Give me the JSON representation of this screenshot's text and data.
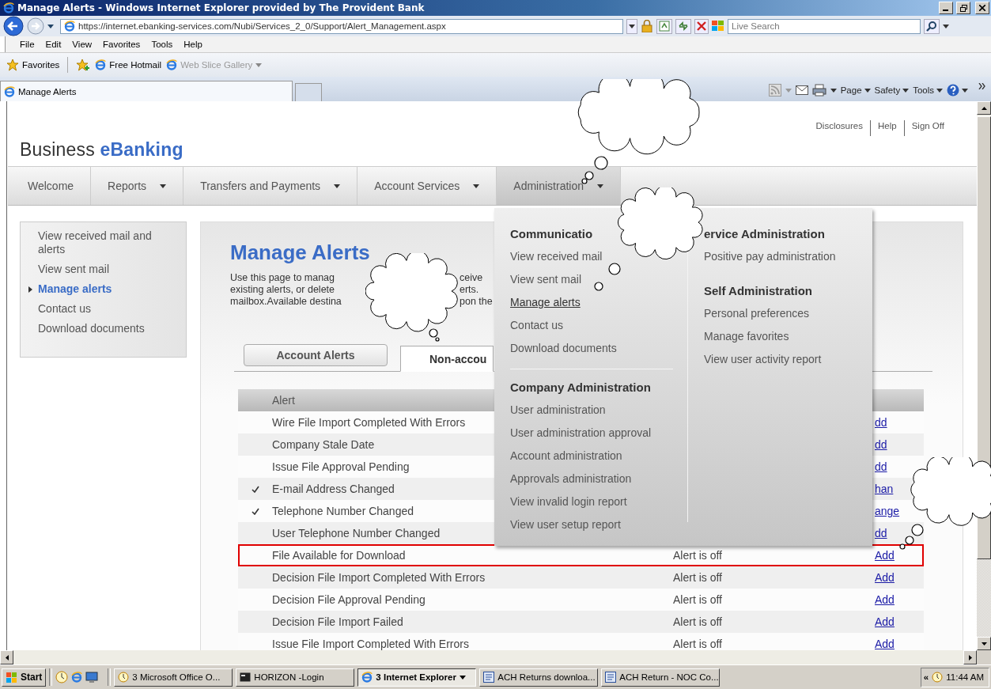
{
  "window": {
    "title": "Manage Alerts - Windows Internet Explorer provided by The Provident Bank"
  },
  "address_bar": {
    "url": "https://internet.ebanking-services.com/Nubi/Services_2_0/Support/Alert_Management.aspx"
  },
  "search": {
    "placeholder": "Live Search"
  },
  "menu_bar": [
    "File",
    "Edit",
    "View",
    "Favorites",
    "Tools",
    "Help"
  ],
  "favorites_bar": {
    "label": "Favorites",
    "links": [
      {
        "label": "Free Hotmail",
        "disabled": false,
        "dropdown": false
      },
      {
        "label": "Web Slice Gallery",
        "disabled": true,
        "dropdown": true
      }
    ]
  },
  "browser_tabs": [
    {
      "label": "Manage Alerts",
      "selected": true
    }
  ],
  "command_bar": [
    "Page",
    "Safety",
    "Tools"
  ],
  "site": {
    "top_links": [
      "Disclosures",
      "Help",
      "Sign Off"
    ],
    "logo": {
      "plain": "Business",
      "accent": "eBanking"
    },
    "nav": [
      {
        "label": "Welcome",
        "dropdown": false,
        "selected": false
      },
      {
        "label": "Reports",
        "dropdown": true,
        "selected": false
      },
      {
        "label": "Transfers and Payments",
        "dropdown": true,
        "selected": false
      },
      {
        "label": "Account Services",
        "dropdown": true,
        "selected": false
      },
      {
        "label": "Administration",
        "dropdown": true,
        "selected": true
      }
    ],
    "sidebar": [
      {
        "label": "View received mail and alerts",
        "selected": false
      },
      {
        "label": "View sent mail",
        "selected": false
      },
      {
        "label": "Manage alerts",
        "selected": true
      },
      {
        "label": "Contact us",
        "selected": false
      },
      {
        "label": "Download documents",
        "selected": false
      }
    ],
    "heading": "Manage Alerts",
    "intro_lines": [
      {
        "left": "Use this page to manag",
        "right": "ceive"
      },
      {
        "left": "existing alerts, or delete",
        "right": "erts."
      },
      {
        "left": "mailbox.Available destina",
        "right": "pon the"
      }
    ],
    "tabs": [
      {
        "label": "Account Alerts",
        "selected": false
      },
      {
        "label": "Non-accou",
        "selected": true
      }
    ],
    "table": {
      "columns": [
        "Alert"
      ],
      "rows": [
        {
          "alert": "Wire File Import Completed With Errors",
          "checked": false,
          "highlighted": false,
          "action": "dd"
        },
        {
          "alert": "Company Stale Date",
          "checked": false,
          "highlighted": false,
          "action": "dd"
        },
        {
          "alert": "Issue File Approval Pending",
          "checked": false,
          "highlighted": false,
          "action": "dd"
        },
        {
          "alert": "E-mail Address Changed",
          "checked": true,
          "highlighted": false,
          "action": "han"
        },
        {
          "alert": "Telephone Number Changed",
          "checked": true,
          "highlighted": false,
          "action": "ange"
        },
        {
          "alert": "User Telephone Number Changed",
          "checked": false,
          "highlighted": false,
          "action": "dd"
        },
        {
          "alert": "File Available for Download",
          "checked": false,
          "highlighted": true,
          "status": "Alert is off",
          "action": "Add"
        },
        {
          "alert": "Decision File Import Completed With Errors",
          "checked": false,
          "highlighted": false,
          "status": "Alert is off",
          "action": "Add"
        },
        {
          "alert": "Decision File Approval Pending",
          "checked": false,
          "highlighted": false,
          "status": "Alert is off",
          "action": "Add"
        },
        {
          "alert": "Decision File Import Failed",
          "checked": false,
          "highlighted": false,
          "status": "Alert is off",
          "action": "Add"
        },
        {
          "alert": "Issue File Import Completed With Errors",
          "checked": false,
          "highlighted": false,
          "status": "Alert is off",
          "action": "Add"
        }
      ]
    }
  },
  "admin_menu": {
    "columns": [
      [
        {
          "heading": "Communicatio",
          "items": [
            {
              "label": "View received mail",
              "selected": false
            },
            {
              "label": "View sent mail",
              "selected": false
            },
            {
              "label": "Manage alerts",
              "selected": true
            },
            {
              "label": "Contact us",
              "selected": false
            },
            {
              "label": "Download documents",
              "selected": false
            }
          ]
        },
        {
          "heading": "Company Administration",
          "items": [
            {
              "label": "User administration",
              "selected": false
            },
            {
              "label": "User administration approval",
              "selected": false
            },
            {
              "label": "Account administration",
              "selected": false
            },
            {
              "label": "Approvals administration",
              "selected": false
            },
            {
              "label": "View invalid login report",
              "selected": false
            },
            {
              "label": "View user setup report",
              "selected": false
            }
          ]
        }
      ],
      [
        {
          "heading": "ervice Administration",
          "items": [
            {
              "label": "Positive pay administration",
              "selected": false
            }
          ]
        },
        {
          "heading": "Self Administration",
          "items": [
            {
              "label": "Personal preferences",
              "selected": false
            },
            {
              "label": "Manage favorites",
              "selected": false
            },
            {
              "label": "View user activity report",
              "selected": false
            }
          ]
        }
      ]
    ]
  },
  "taskbar": {
    "start": "Start",
    "items": [
      {
        "label": "3 Microsoft Office O...",
        "selected": false,
        "kind": "clock"
      },
      {
        "label": "HORIZON -Login",
        "selected": false,
        "kind": "terminal"
      },
      {
        "label": "3 Internet Explorer",
        "selected": true,
        "kind": "browser"
      },
      {
        "label": "ACH Returns downloa...",
        "selected": false,
        "kind": "document"
      },
      {
        "label": "ACH Return - NOC Co...",
        "selected": false,
        "kind": "document"
      }
    ],
    "tray_toggle": "«",
    "clock": "11:44 AM"
  }
}
